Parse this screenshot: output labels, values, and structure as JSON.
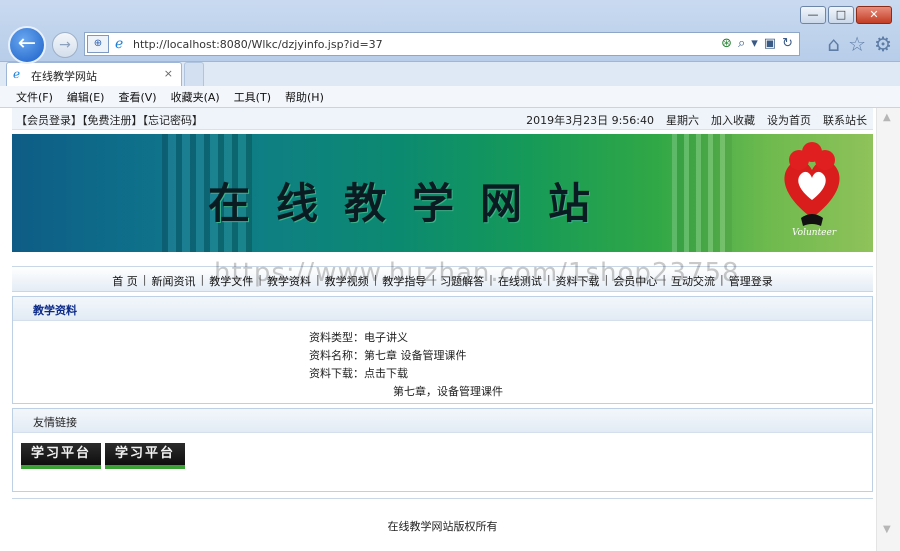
{
  "browser": {
    "url": "http://localhost:8080/Wlkc/dzjyinfo.jsp?id=37",
    "tab_title": "在线教学网站",
    "tab_close": "×",
    "window_buttons": {
      "minimize": "—",
      "maximize": "□",
      "close": "✕"
    },
    "back": "←",
    "forward": "→",
    "menu": [
      "文件(F)",
      "编辑(E)",
      "查看(V)",
      "收藏夹(A)",
      "工具(T)",
      "帮助(H)"
    ],
    "icons": [
      "home-icon",
      "favorites-star-icon",
      "settings-gear-icon",
      "search-icon",
      "refresh-icon",
      "compatibility-icon"
    ]
  },
  "topbar": {
    "left": "【会员登录】【免费注册】【忘记密码】",
    "datetime": "2019年3月23日  9:56:40",
    "weekday": "星期六",
    "links": [
      "加入收藏",
      "设为首页",
      "联系站长"
    ]
  },
  "banner": {
    "title": "在线教学网站",
    "logo_text": "Volunteer"
  },
  "nav": [
    "首 页",
    "新闻资讯",
    "教学文件",
    "教学资料",
    "教学视频",
    "教学指导",
    "习题解答",
    "在线测试",
    "资料下载",
    "会员中心",
    "互动交流",
    "管理登录"
  ],
  "watermark": "https://www.huzhan.com/1shop23758",
  "material": {
    "heading": "教学资料",
    "type_label": "资料类型：",
    "type_value": "电子讲义",
    "name_label": "资料名称：",
    "name_value": "第七章 设备管理课件",
    "download_label": "资料下载：",
    "download_value": "点击下载",
    "description": "第七章，设备管理课件"
  },
  "friend_links": {
    "heading": "友情链接",
    "items": [
      "学习平台",
      "学习平台"
    ]
  },
  "footer": "在线教学网站版权所有"
}
